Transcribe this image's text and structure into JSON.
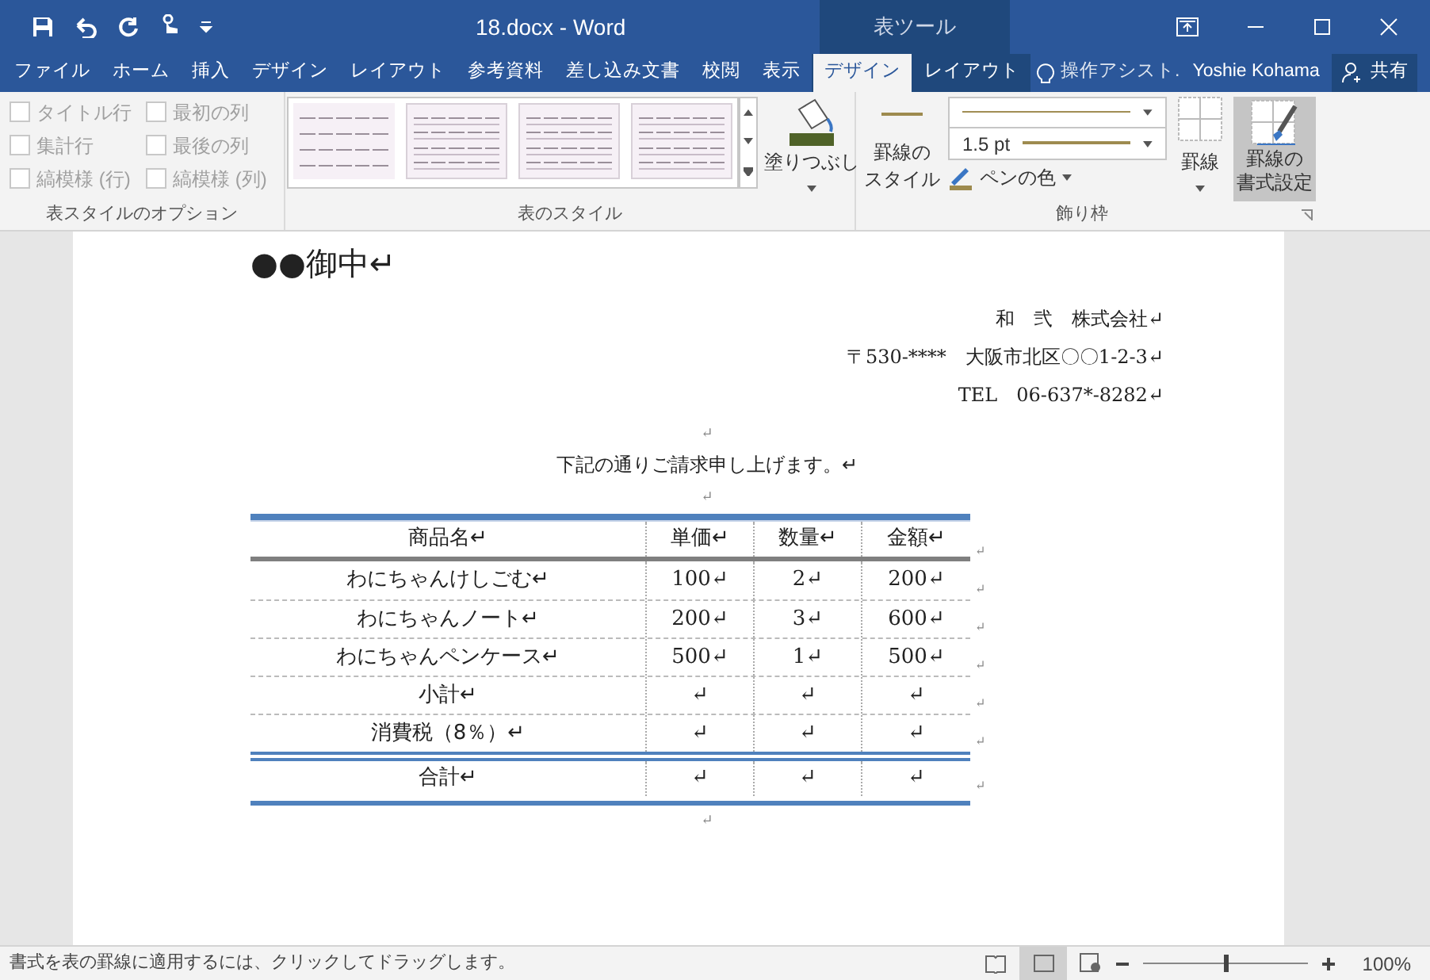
{
  "window": {
    "title": "18.docx - Word",
    "context_label": "表ツール"
  },
  "tabs": [
    {
      "label": "ファイル",
      "selected": false,
      "contextual": false
    },
    {
      "label": "ホーム",
      "selected": false,
      "contextual": false
    },
    {
      "label": "挿入",
      "selected": false,
      "contextual": false
    },
    {
      "label": "デザイン",
      "selected": false,
      "contextual": false
    },
    {
      "label": "レイアウト",
      "selected": false,
      "contextual": false
    },
    {
      "label": "参考資料",
      "selected": false,
      "contextual": false
    },
    {
      "label": "差し込み文書",
      "selected": false,
      "contextual": false
    },
    {
      "label": "校閲",
      "selected": false,
      "contextual": false
    },
    {
      "label": "表示",
      "selected": false,
      "contextual": false
    },
    {
      "label": "デザイン",
      "selected": true,
      "contextual": true
    },
    {
      "label": "レイアウト",
      "selected": false,
      "contextual": true
    }
  ],
  "tell_me": "操作アシスト.",
  "user": "Yoshie Kohama",
  "share": "共有",
  "style_options": {
    "label": "表スタイルのオプション",
    "items": [
      {
        "label": "タイトル行",
        "checked": false
      },
      {
        "label": "最初の列",
        "checked": false
      },
      {
        "label": "集計行",
        "checked": false
      },
      {
        "label": "最後の列",
        "checked": false
      },
      {
        "label": "縞模様 (行)",
        "checked": false
      },
      {
        "label": "縞模様 (列)",
        "checked": false
      }
    ]
  },
  "table_styles": {
    "label": "表のスタイル",
    "shading": "塗りつぶし"
  },
  "borders": {
    "label": "飾り枠",
    "border_style": [
      "罫線の",
      "スタイル"
    ],
    "weight": "1.5 pt",
    "pen_color": "ペンの色",
    "borders": "罫線",
    "painter": [
      "罫線の",
      "書式設定"
    ],
    "painter_selected": true
  },
  "document": {
    "addressee": "●●御中↵",
    "sender": [
      "和　弐　株式会社↵",
      "〒530-****　大阪市北区〇〇1-2-3↵",
      "TEL　06-637*-8282↵"
    ],
    "blank1": "↵",
    "intro": "下記の通りご請求申し上げます。↵",
    "blank2": "↵",
    "table": {
      "header": [
        "商品名↵",
        "単価↵",
        "数量↵",
        "金額↵"
      ],
      "rows": [
        {
          "kind": "item",
          "cells": [
            "わにちゃんけしごむ↵",
            "100↵",
            "2↵",
            "200↵"
          ]
        },
        {
          "kind": "item",
          "cells": [
            "わにちゃんノート↵",
            "200↵",
            "3↵",
            "600↵"
          ]
        },
        {
          "kind": "item",
          "cells": [
            "わにちゃんペンケース↵",
            "500↵",
            "1↵",
            "500↵"
          ]
        },
        {
          "kind": "item",
          "cells": [
            "小計↵",
            "↵",
            "↵",
            "↵"
          ]
        },
        {
          "kind": "item",
          "cells": [
            "消費税（8％）↵",
            "↵",
            "↵",
            "↵"
          ]
        },
        {
          "kind": "total",
          "cells": [
            "合計↵",
            "↵",
            "↵",
            "↵"
          ]
        }
      ],
      "row_end_marks": [
        "↵",
        "↵",
        "↵",
        "↵",
        "↵",
        "↵",
        "↵"
      ]
    },
    "blank3": "↵"
  },
  "status_bar": {
    "message": "書式を表の罫線に適用するには、クリックしてドラッグします。",
    "zoom": "100%",
    "zoom_slider": {
      "level": 0.5
    }
  }
}
